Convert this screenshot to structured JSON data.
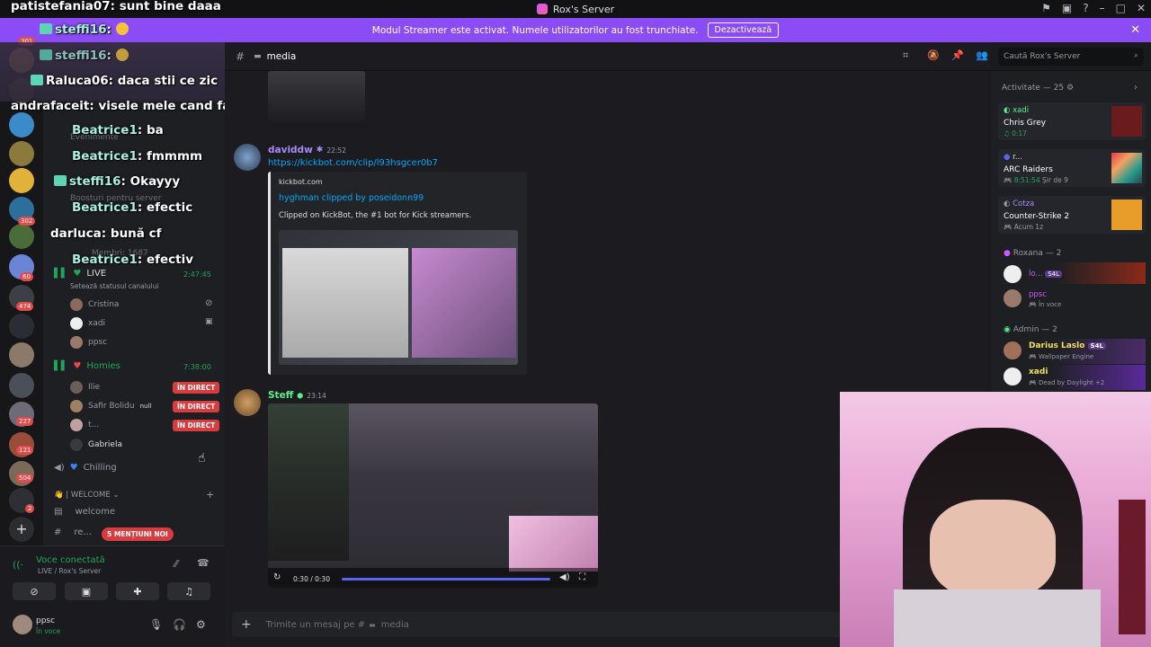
{
  "window": {
    "title": "Rox's Server"
  },
  "banner": {
    "text": "Modul Streamer este activat. Numele utilizatorilor au fost trunchiate.",
    "button": "Dezactivează"
  },
  "rail_badges": [
    "301",
    "302",
    "60",
    "474",
    "227",
    "121",
    "504",
    "2"
  ],
  "overlay_chat": [
    {
      "name": "patistefania07",
      "text": "sunt bine daaa"
    },
    {
      "name": "steffi16",
      "text": ""
    },
    {
      "name": "steffi16",
      "text": ""
    },
    {
      "name": "Raluca06",
      "text": "daca stii ce zic"
    },
    {
      "name": "andrafaceit",
      "text": "visele mele cand fac febra"
    },
    {
      "name": "Beatrice1",
      "text": "ba"
    },
    {
      "name": "Beatrice1",
      "text": "fmmmm"
    },
    {
      "name": "steffi16",
      "text": "Okayyy"
    },
    {
      "name": "Beatrice1",
      "text": "efectic"
    },
    {
      "name": "darluca",
      "text": "bună cf"
    },
    {
      "name": "Beatrice1",
      "text": "efectiv"
    }
  ],
  "sidebar": {
    "hidden_items": [
      "Evenimente",
      "Boosturi pentru server",
      "Membri: 1687"
    ],
    "voice_live": {
      "label": "LIVE",
      "time": "2:47:45",
      "status": "Setează statusul canalului"
    },
    "live_members": [
      "Cristina",
      "xadi",
      "ppsc"
    ],
    "homies": {
      "label": "Homies",
      "time": "7:38:00"
    },
    "homies_members": [
      {
        "name": "Ilie",
        "live": "ÎN DIRECT"
      },
      {
        "name": "Safir Bolidu",
        "tag": "null",
        "live": "ÎN DIRECT"
      },
      {
        "name": "t...",
        "live": "ÎN DIRECT"
      },
      {
        "name": "Gabriela",
        "live": ""
      }
    ],
    "chilling": "Chilling",
    "category": "| WELCOME",
    "channels": [
      "welcome",
      "re..."
    ],
    "mentions_pill": "5 MENȚIUNI NOI"
  },
  "voice_connected": {
    "title": "Voce conectată",
    "subtitle": "LIVE / Rox's Server"
  },
  "user": {
    "name": "ppsc",
    "status": "În voce"
  },
  "channel": {
    "name": "media"
  },
  "search": {
    "placeholder": "Caută Rox's Server"
  },
  "messages": [
    {
      "author": "daviddw",
      "time": "22:52",
      "link": "https://kickbot.com/clip/l93hsgcer0b7",
      "embed": {
        "provider": "kickbot.com",
        "title": "hyghman clipped by poseidonn99",
        "description": "Clipped on KickBot, the #1 bot for Kick streamers."
      }
    },
    {
      "author": "Steff",
      "time": "23:14",
      "video": {
        "time": "0:30 / 0:30",
        "progress": 1.0
      }
    }
  ],
  "composer": {
    "placeholder": "Trimite un mesaj pe #",
    "channel": "media"
  },
  "members": {
    "activity_header": "Activitate — 25",
    "activities": [
      {
        "user": "xadi",
        "title": "Chris Grey",
        "sub": "0:17"
      },
      {
        "user": "r...",
        "title": "ARC Raiders",
        "sub": "8:51:54",
        "extra": "Șir de 9"
      },
      {
        "user": "Cotza",
        "title": "Counter-Strike 2",
        "sub": "Acum 1z"
      }
    ],
    "roxana_header": "Roxana — 2",
    "roxana": [
      {
        "name": "lo...",
        "tag": "S4L"
      },
      {
        "name": "ppsc",
        "sub": "În voce"
      }
    ],
    "admin_header": "Admin — 2",
    "admins": [
      {
        "name": "Darius Laslo",
        "tag": "S4L",
        "sub": "Wallpaper Engine"
      },
      {
        "name": "xadi",
        "sub": "Dead by Daylight +2"
      }
    ]
  },
  "colors": {
    "accent": "#8c4cf5",
    "live_red": "#d83c3e",
    "link": "#00a8fc",
    "online": "#23a559"
  }
}
